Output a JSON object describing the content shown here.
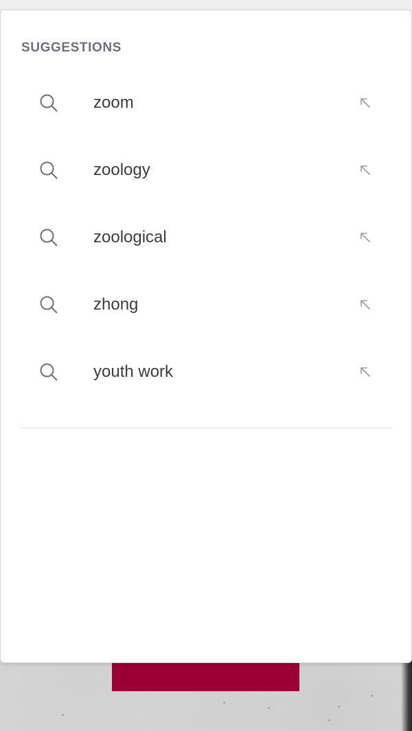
{
  "suggestions": {
    "heading": "SUGGESTIONS",
    "items": [
      {
        "label": "zoom",
        "icon": "search-icon",
        "action_icon": "arrow-up-left-icon"
      },
      {
        "label": "zoology",
        "icon": "search-icon",
        "action_icon": "arrow-up-left-icon"
      },
      {
        "label": "zoological",
        "icon": "search-icon",
        "action_icon": "arrow-up-left-icon"
      },
      {
        "label": "zhong",
        "icon": "search-icon",
        "action_icon": "arrow-up-left-icon"
      },
      {
        "label": "youth work",
        "icon": "search-icon",
        "action_icon": "arrow-up-left-icon"
      }
    ]
  },
  "colors": {
    "heading": "#6b6f80",
    "text": "#3c3c3c",
    "icon": "#6b6f80",
    "arrow": "#9a9cae",
    "accent_block": "#9a0033"
  }
}
